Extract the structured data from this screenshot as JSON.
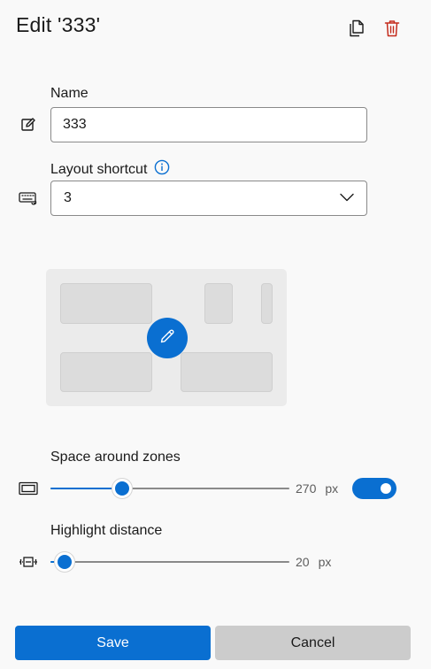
{
  "header": {
    "title": "Edit '333'",
    "copy_icon": "copy-icon",
    "delete_icon": "trash-icon"
  },
  "name_field": {
    "label": "Name",
    "value": "333",
    "icon": "rename-icon"
  },
  "shortcut_field": {
    "label": "Layout shortcut",
    "info_icon": "info-icon",
    "icon": "keyboard-icon",
    "selected": "3"
  },
  "preview": {
    "edit_icon": "pencil-icon"
  },
  "space_around_zones": {
    "label": "Space around zones",
    "icon": "zone-spacing-icon",
    "value": "270",
    "unit": "px",
    "slider_fraction": 0.3,
    "enabled": true
  },
  "highlight_distance": {
    "label": "Highlight distance",
    "icon": "highlight-distance-icon",
    "value": "20",
    "unit": "px",
    "slider_fraction": 0.06
  },
  "footer": {
    "save_label": "Save",
    "cancel_label": "Cancel"
  },
  "colors": {
    "accent": "#0a6fd1",
    "delete": "#c42b1c"
  }
}
